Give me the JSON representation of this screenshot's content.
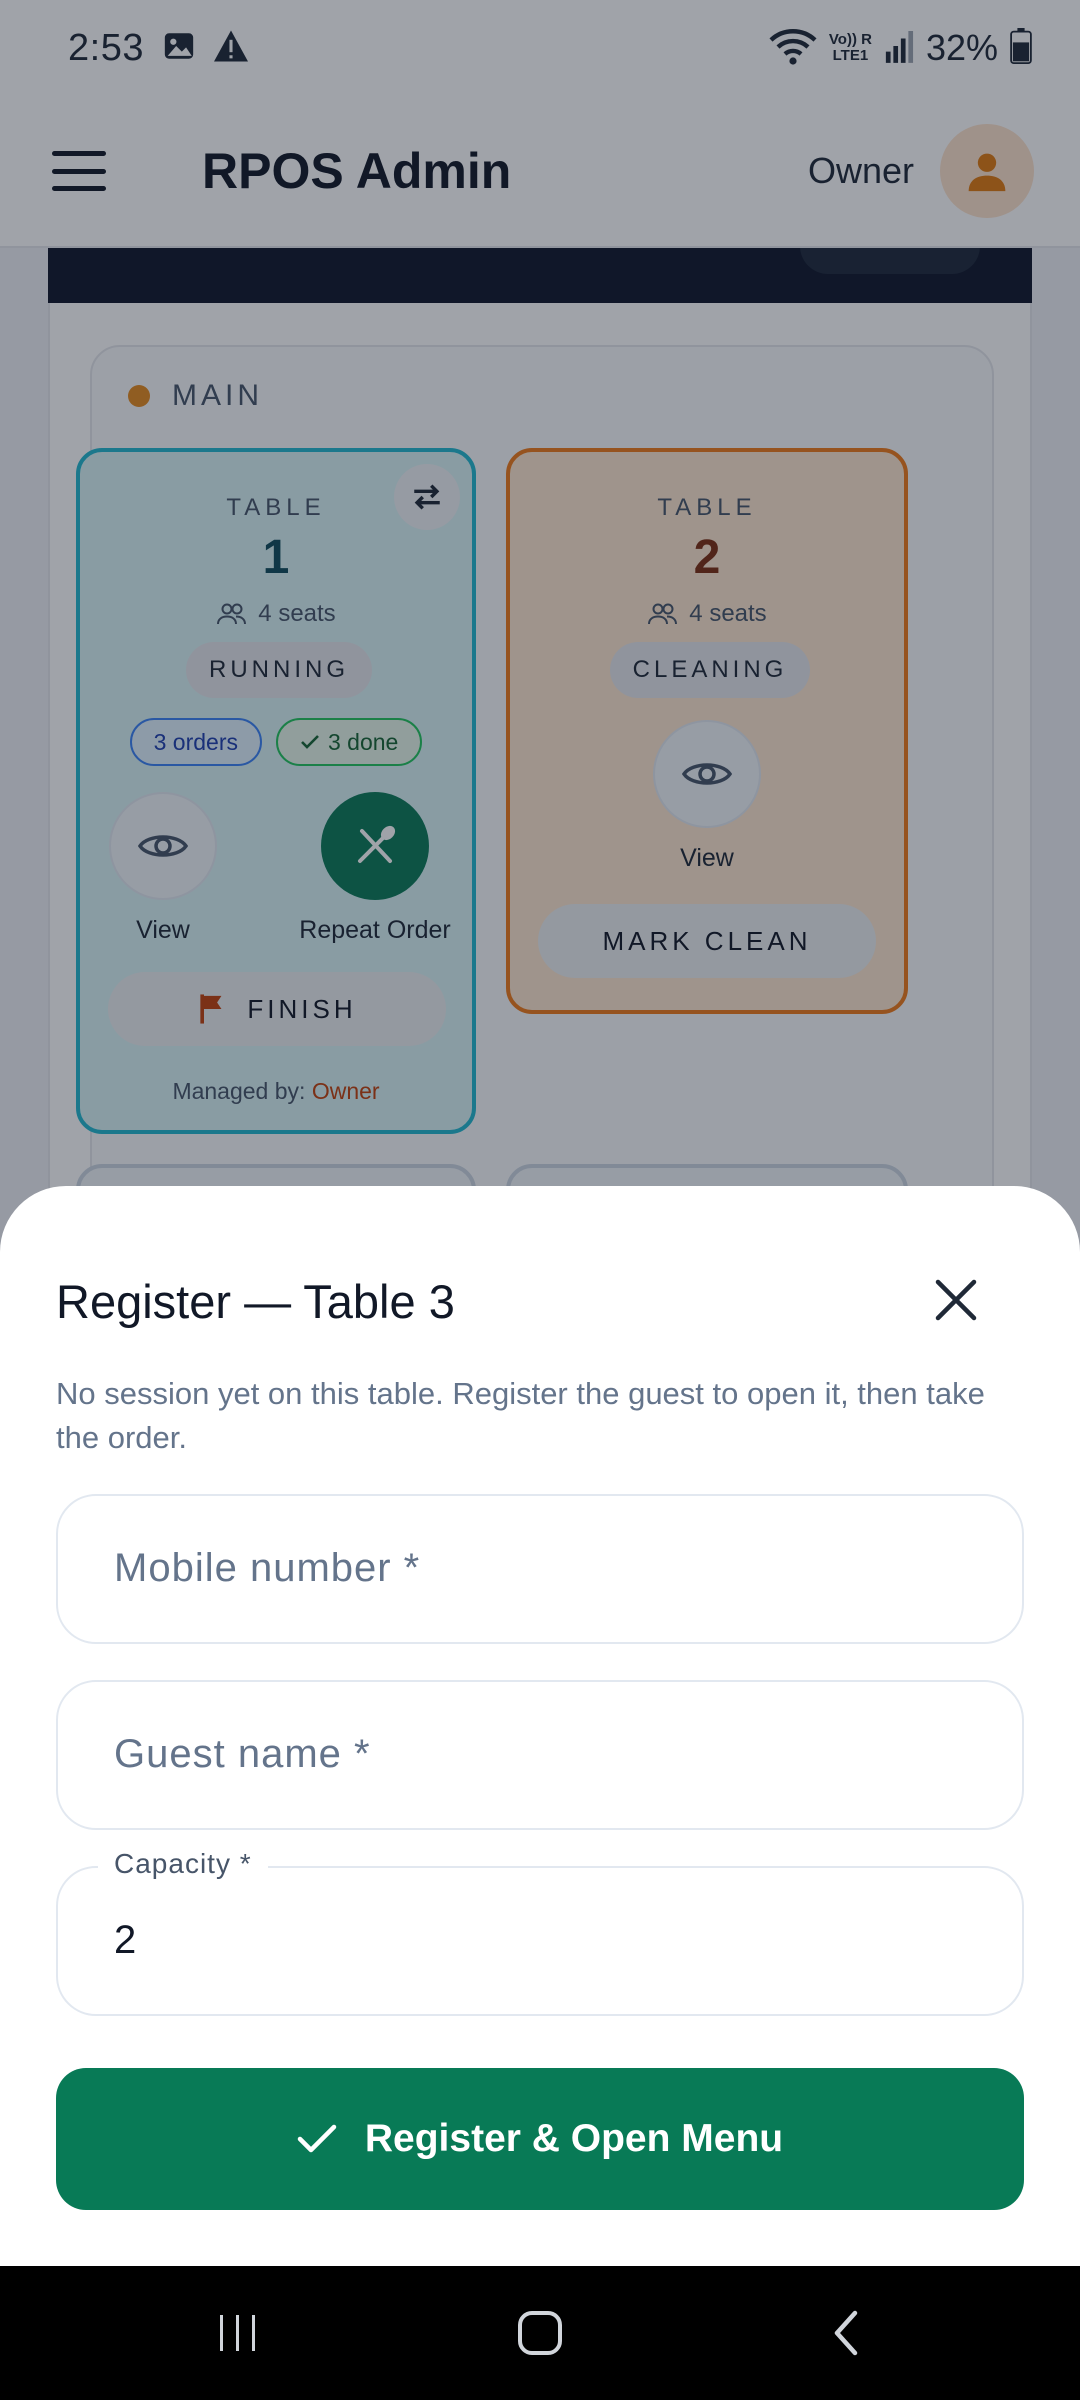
{
  "status_bar": {
    "time": "2:53",
    "network_top": "Vo)) R",
    "network_bottom": "LTE1",
    "battery": "32%"
  },
  "app_bar": {
    "title": "RPOS Admin",
    "user_label": "Owner"
  },
  "section": {
    "name": "MAIN",
    "dot_color": "#e58a1f"
  },
  "tables": [
    {
      "label": "TABLE",
      "number": "1",
      "seats": "4 seats",
      "status": "RUNNING",
      "orders_chip": "3 orders",
      "done_chip": "3 done",
      "view_label": "View",
      "repeat_label": "Repeat Order",
      "finish_label": "FINISH",
      "managed_prefix": "Managed by: ",
      "managed_by": "Owner",
      "accent": "#22b8cf"
    },
    {
      "label": "TABLE",
      "number": "2",
      "seats": "4 seats",
      "status": "CLEANING",
      "view_label": "View",
      "mark_clean_label": "MARK CLEAN",
      "accent": "#ef7a19"
    }
  ],
  "sheet": {
    "title": "Register — Table 3",
    "description": "No session yet on this table. Register the guest to open it, then take the order.",
    "mobile_placeholder": "Mobile number *",
    "guest_placeholder": "Guest name *",
    "capacity_label": "Capacity *",
    "capacity_value": "2",
    "submit_label": "Register & Open Menu",
    "submit_color": "#087a56"
  }
}
